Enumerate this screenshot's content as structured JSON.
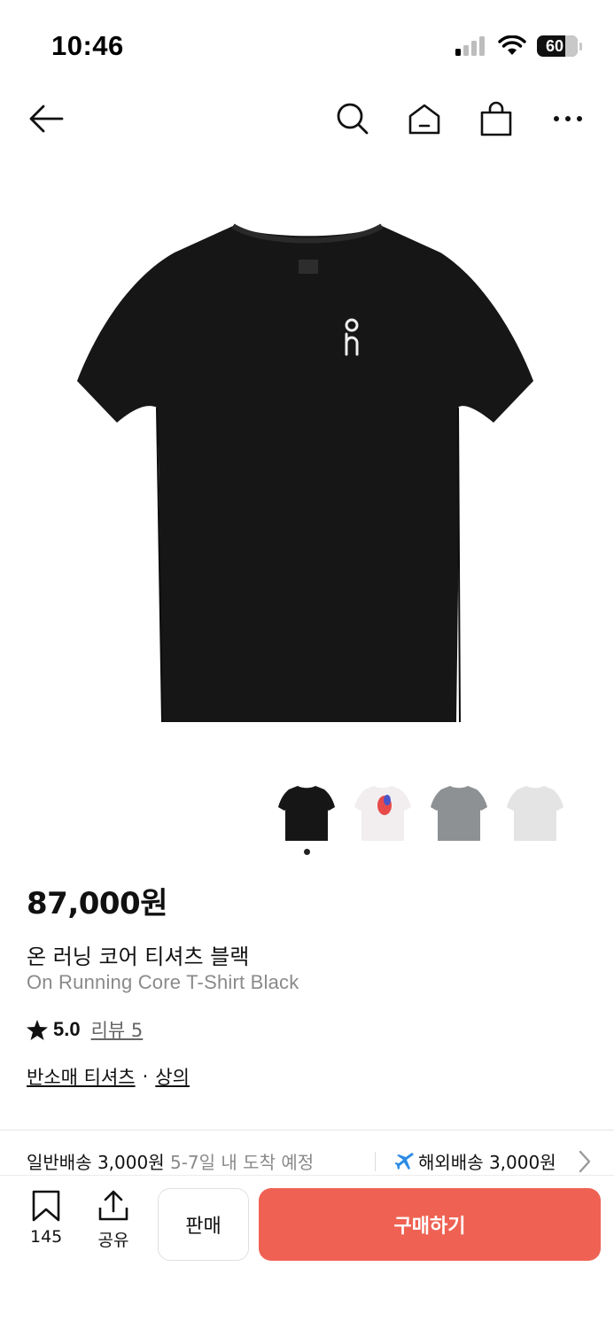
{
  "status_bar": {
    "time": "10:46",
    "battery": "60"
  },
  "nav": {
    "icons": [
      "back-arrow-icon",
      "search-icon",
      "home-icon",
      "shopping-bag-icon",
      "more-icon"
    ]
  },
  "product": {
    "thumbnail_icons": [
      "black-tee-thumb",
      "white-graphic-tee-thumb",
      "gray-tee-thumb",
      "white-tee-thumb"
    ],
    "selected_thumbnail_index": 0,
    "price": "87,000원",
    "name_ko": "온 러닝 코어 티셔츠 블랙",
    "name_en": "On Running Core T-Shirt Black",
    "rating": "5.0",
    "review_link": "리뷰 5",
    "category_primary": "반소매 티셔츠",
    "category_separator": "·",
    "category_secondary": "상의"
  },
  "shipping": {
    "normal_label": "일반배송 3,000원",
    "normal_eta": "5-7일 내 도착 예정",
    "overseas_label": "해외배송 3,000원"
  },
  "bottom_bar": {
    "bookmark_count": "145",
    "share_label": "공유",
    "sell_label": "판매",
    "buy_label": "구매하기"
  },
  "colors": {
    "accent_buy": "#ef6253",
    "overseas_plane": "#2b8be6"
  }
}
